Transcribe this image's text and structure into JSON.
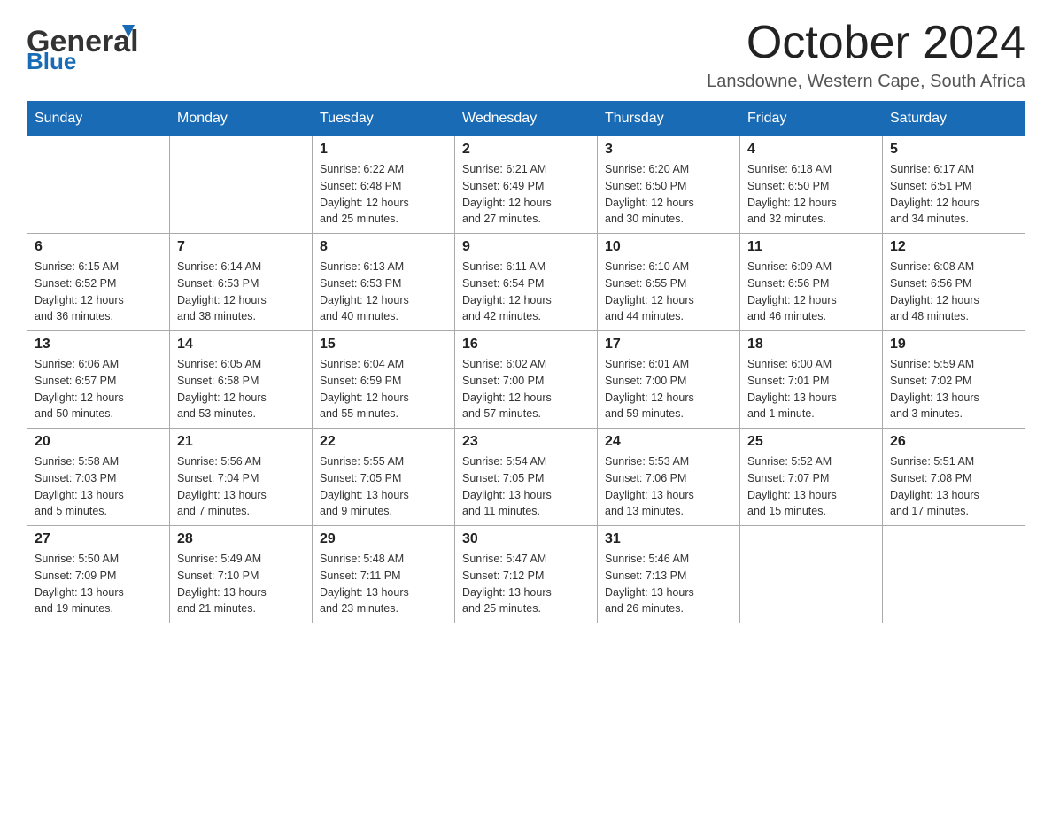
{
  "header": {
    "logo_general": "General",
    "logo_blue": "Blue",
    "month_title": "October 2024",
    "location": "Lansdowne, Western Cape, South Africa"
  },
  "weekdays": [
    "Sunday",
    "Monday",
    "Tuesday",
    "Wednesday",
    "Thursday",
    "Friday",
    "Saturday"
  ],
  "weeks": [
    [
      {
        "day": "",
        "info": ""
      },
      {
        "day": "",
        "info": ""
      },
      {
        "day": "1",
        "info": "Sunrise: 6:22 AM\nSunset: 6:48 PM\nDaylight: 12 hours\nand 25 minutes."
      },
      {
        "day": "2",
        "info": "Sunrise: 6:21 AM\nSunset: 6:49 PM\nDaylight: 12 hours\nand 27 minutes."
      },
      {
        "day": "3",
        "info": "Sunrise: 6:20 AM\nSunset: 6:50 PM\nDaylight: 12 hours\nand 30 minutes."
      },
      {
        "day": "4",
        "info": "Sunrise: 6:18 AM\nSunset: 6:50 PM\nDaylight: 12 hours\nand 32 minutes."
      },
      {
        "day": "5",
        "info": "Sunrise: 6:17 AM\nSunset: 6:51 PM\nDaylight: 12 hours\nand 34 minutes."
      }
    ],
    [
      {
        "day": "6",
        "info": "Sunrise: 6:15 AM\nSunset: 6:52 PM\nDaylight: 12 hours\nand 36 minutes."
      },
      {
        "day": "7",
        "info": "Sunrise: 6:14 AM\nSunset: 6:53 PM\nDaylight: 12 hours\nand 38 minutes."
      },
      {
        "day": "8",
        "info": "Sunrise: 6:13 AM\nSunset: 6:53 PM\nDaylight: 12 hours\nand 40 minutes."
      },
      {
        "day": "9",
        "info": "Sunrise: 6:11 AM\nSunset: 6:54 PM\nDaylight: 12 hours\nand 42 minutes."
      },
      {
        "day": "10",
        "info": "Sunrise: 6:10 AM\nSunset: 6:55 PM\nDaylight: 12 hours\nand 44 minutes."
      },
      {
        "day": "11",
        "info": "Sunrise: 6:09 AM\nSunset: 6:56 PM\nDaylight: 12 hours\nand 46 minutes."
      },
      {
        "day": "12",
        "info": "Sunrise: 6:08 AM\nSunset: 6:56 PM\nDaylight: 12 hours\nand 48 minutes."
      }
    ],
    [
      {
        "day": "13",
        "info": "Sunrise: 6:06 AM\nSunset: 6:57 PM\nDaylight: 12 hours\nand 50 minutes."
      },
      {
        "day": "14",
        "info": "Sunrise: 6:05 AM\nSunset: 6:58 PM\nDaylight: 12 hours\nand 53 minutes."
      },
      {
        "day": "15",
        "info": "Sunrise: 6:04 AM\nSunset: 6:59 PM\nDaylight: 12 hours\nand 55 minutes."
      },
      {
        "day": "16",
        "info": "Sunrise: 6:02 AM\nSunset: 7:00 PM\nDaylight: 12 hours\nand 57 minutes."
      },
      {
        "day": "17",
        "info": "Sunrise: 6:01 AM\nSunset: 7:00 PM\nDaylight: 12 hours\nand 59 minutes."
      },
      {
        "day": "18",
        "info": "Sunrise: 6:00 AM\nSunset: 7:01 PM\nDaylight: 13 hours\nand 1 minute."
      },
      {
        "day": "19",
        "info": "Sunrise: 5:59 AM\nSunset: 7:02 PM\nDaylight: 13 hours\nand 3 minutes."
      }
    ],
    [
      {
        "day": "20",
        "info": "Sunrise: 5:58 AM\nSunset: 7:03 PM\nDaylight: 13 hours\nand 5 minutes."
      },
      {
        "day": "21",
        "info": "Sunrise: 5:56 AM\nSunset: 7:04 PM\nDaylight: 13 hours\nand 7 minutes."
      },
      {
        "day": "22",
        "info": "Sunrise: 5:55 AM\nSunset: 7:05 PM\nDaylight: 13 hours\nand 9 minutes."
      },
      {
        "day": "23",
        "info": "Sunrise: 5:54 AM\nSunset: 7:05 PM\nDaylight: 13 hours\nand 11 minutes."
      },
      {
        "day": "24",
        "info": "Sunrise: 5:53 AM\nSunset: 7:06 PM\nDaylight: 13 hours\nand 13 minutes."
      },
      {
        "day": "25",
        "info": "Sunrise: 5:52 AM\nSunset: 7:07 PM\nDaylight: 13 hours\nand 15 minutes."
      },
      {
        "day": "26",
        "info": "Sunrise: 5:51 AM\nSunset: 7:08 PM\nDaylight: 13 hours\nand 17 minutes."
      }
    ],
    [
      {
        "day": "27",
        "info": "Sunrise: 5:50 AM\nSunset: 7:09 PM\nDaylight: 13 hours\nand 19 minutes."
      },
      {
        "day": "28",
        "info": "Sunrise: 5:49 AM\nSunset: 7:10 PM\nDaylight: 13 hours\nand 21 minutes."
      },
      {
        "day": "29",
        "info": "Sunrise: 5:48 AM\nSunset: 7:11 PM\nDaylight: 13 hours\nand 23 minutes."
      },
      {
        "day": "30",
        "info": "Sunrise: 5:47 AM\nSunset: 7:12 PM\nDaylight: 13 hours\nand 25 minutes."
      },
      {
        "day": "31",
        "info": "Sunrise: 5:46 AM\nSunset: 7:13 PM\nDaylight: 13 hours\nand 26 minutes."
      },
      {
        "day": "",
        "info": ""
      },
      {
        "day": "",
        "info": ""
      }
    ]
  ]
}
